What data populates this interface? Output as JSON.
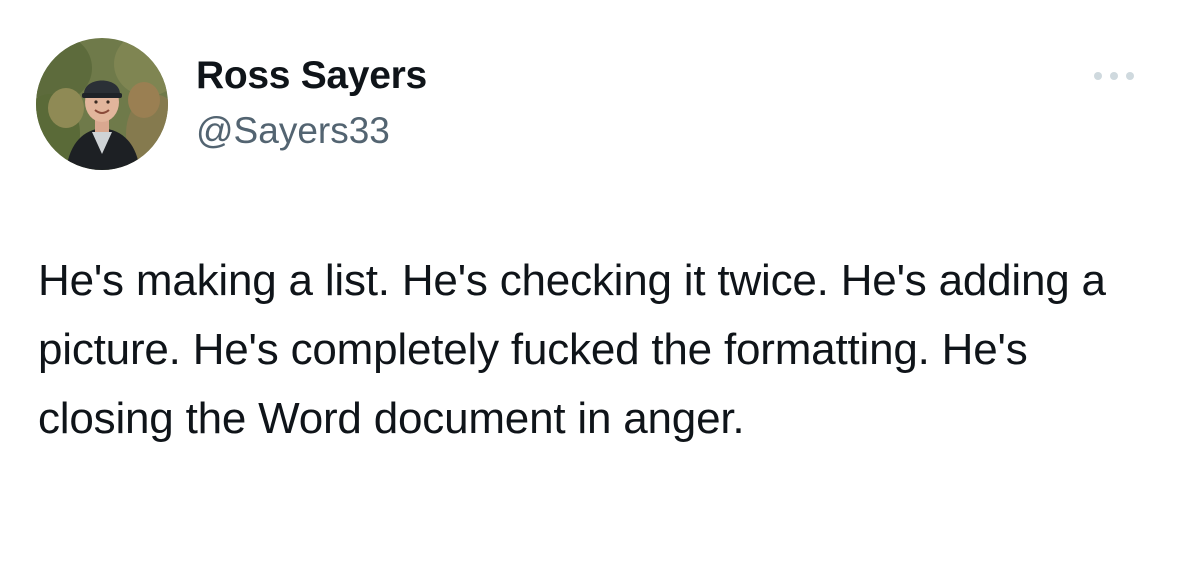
{
  "author": {
    "name": "Ross Sayers",
    "handle": "@Sayers33",
    "avatar_icon": "profile-photo"
  },
  "actions": {
    "more_icon": "ellipsis-icon"
  },
  "tweet": {
    "text": "He's making a list. He's checking it twice. He's adding a picture. He's completely fucked the formatting. He's closing the Word document in anger."
  },
  "colors": {
    "text_primary": "#0f1419",
    "text_secondary": "#536471",
    "more_icon": "#cfd9de",
    "background": "#ffffff"
  }
}
